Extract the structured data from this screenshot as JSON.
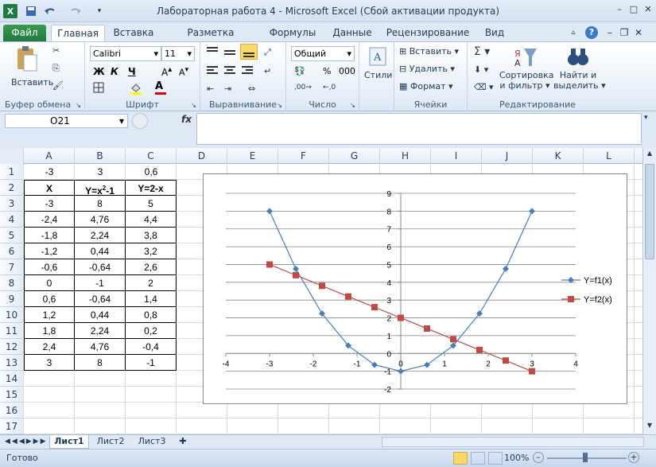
{
  "app": {
    "title": "Лабораторная работа 4  -  Microsoft Excel (Сбой активации продукта)",
    "icon": "X"
  },
  "tabs": [
    "Файл",
    "Главная",
    "Вставка",
    "Разметка страницы",
    "Формулы",
    "Данные",
    "Рецензирование",
    "Вид"
  ],
  "ribbon": {
    "clipboard": {
      "paste": "Вставить",
      "label": "Буфер обмена"
    },
    "font": {
      "name": "Calibri",
      "size": "11",
      "bold": "Ж",
      "italic": "К",
      "underline": "Ч",
      "label": "Шрифт"
    },
    "alignment": {
      "label": "Выравнивание"
    },
    "number": {
      "format": "Общий",
      "percent": "%",
      "thousands": "000",
      "label": "Число"
    },
    "styles": {
      "label": "Стили"
    },
    "cells": {
      "insert": "Вставить",
      "delete": "Удалить",
      "format": "Формат",
      "label": "Ячейки"
    },
    "editing": {
      "sort1": "Сортировка",
      "sort2": "и фильтр",
      "find1": "Найти и",
      "find2": "выделить",
      "label": "Редактирование"
    }
  },
  "formula_bar": {
    "name_box": "O21",
    "fx": "fx",
    "value": ""
  },
  "columns": [
    "A",
    "B",
    "C",
    "D",
    "E",
    "F",
    "G",
    "H",
    "I",
    "J",
    "K",
    "L"
  ],
  "rows": [
    "1",
    "2",
    "3",
    "4",
    "5",
    "6",
    "7",
    "8",
    "9",
    "10",
    "11",
    "12",
    "13",
    "14",
    "15",
    "16",
    "17"
  ],
  "cells": [
    [
      "-3",
      "3",
      "0,6"
    ],
    [
      "X",
      "Y=x²-1",
      "Y=2-x"
    ],
    [
      "-3",
      "8",
      "5"
    ],
    [
      "-2,4",
      "4,76",
      "4,4"
    ],
    [
      "-1,8",
      "2,24",
      "3,8"
    ],
    [
      "-1,2",
      "0,44",
      "3,2"
    ],
    [
      "-0,6",
      "-0,64",
      "2,6"
    ],
    [
      "0",
      "-1",
      "2"
    ],
    [
      "0,6",
      "-0,64",
      "1,4"
    ],
    [
      "1,2",
      "0,44",
      "0,8"
    ],
    [
      "1,8",
      "2,24",
      "0,2"
    ],
    [
      "2,4",
      "4,76",
      "-0,4"
    ],
    [
      "3",
      "8",
      "-1"
    ]
  ],
  "chart_data": {
    "type": "scatter",
    "x": [
      -3,
      -2.4,
      -1.8,
      -1.2,
      -0.6,
      0,
      0.6,
      1.2,
      1.8,
      2.4,
      3
    ],
    "series": [
      {
        "name": "Y=f1(x)",
        "values": [
          8,
          4.76,
          2.24,
          0.44,
          -0.64,
          -1,
          -0.64,
          0.44,
          2.24,
          4.76,
          8
        ],
        "color": "#4a7ebb",
        "marker": "diamond"
      },
      {
        "name": "Y=f2(x)",
        "values": [
          5,
          4.4,
          3.8,
          3.2,
          2.6,
          2,
          1.4,
          0.8,
          0.2,
          -0.4,
          -1
        ],
        "color": "#be4b48",
        "marker": "square"
      }
    ],
    "xlim": [
      -4,
      4
    ],
    "ylim": [
      -2,
      9
    ],
    "xticks": [
      "-4",
      "-3",
      "-2",
      "-1",
      "0",
      "1",
      "2",
      "3",
      "4"
    ],
    "yticks": [
      "-2",
      "-1",
      "0",
      "1",
      "2",
      "3",
      "4",
      "5",
      "6",
      "7",
      "8",
      "9"
    ],
    "grid": true,
    "legend": "right"
  },
  "sheets": [
    "Лист1",
    "Лист2",
    "Лист3"
  ],
  "status": {
    "ready": "Готово",
    "zoom": "100%"
  }
}
